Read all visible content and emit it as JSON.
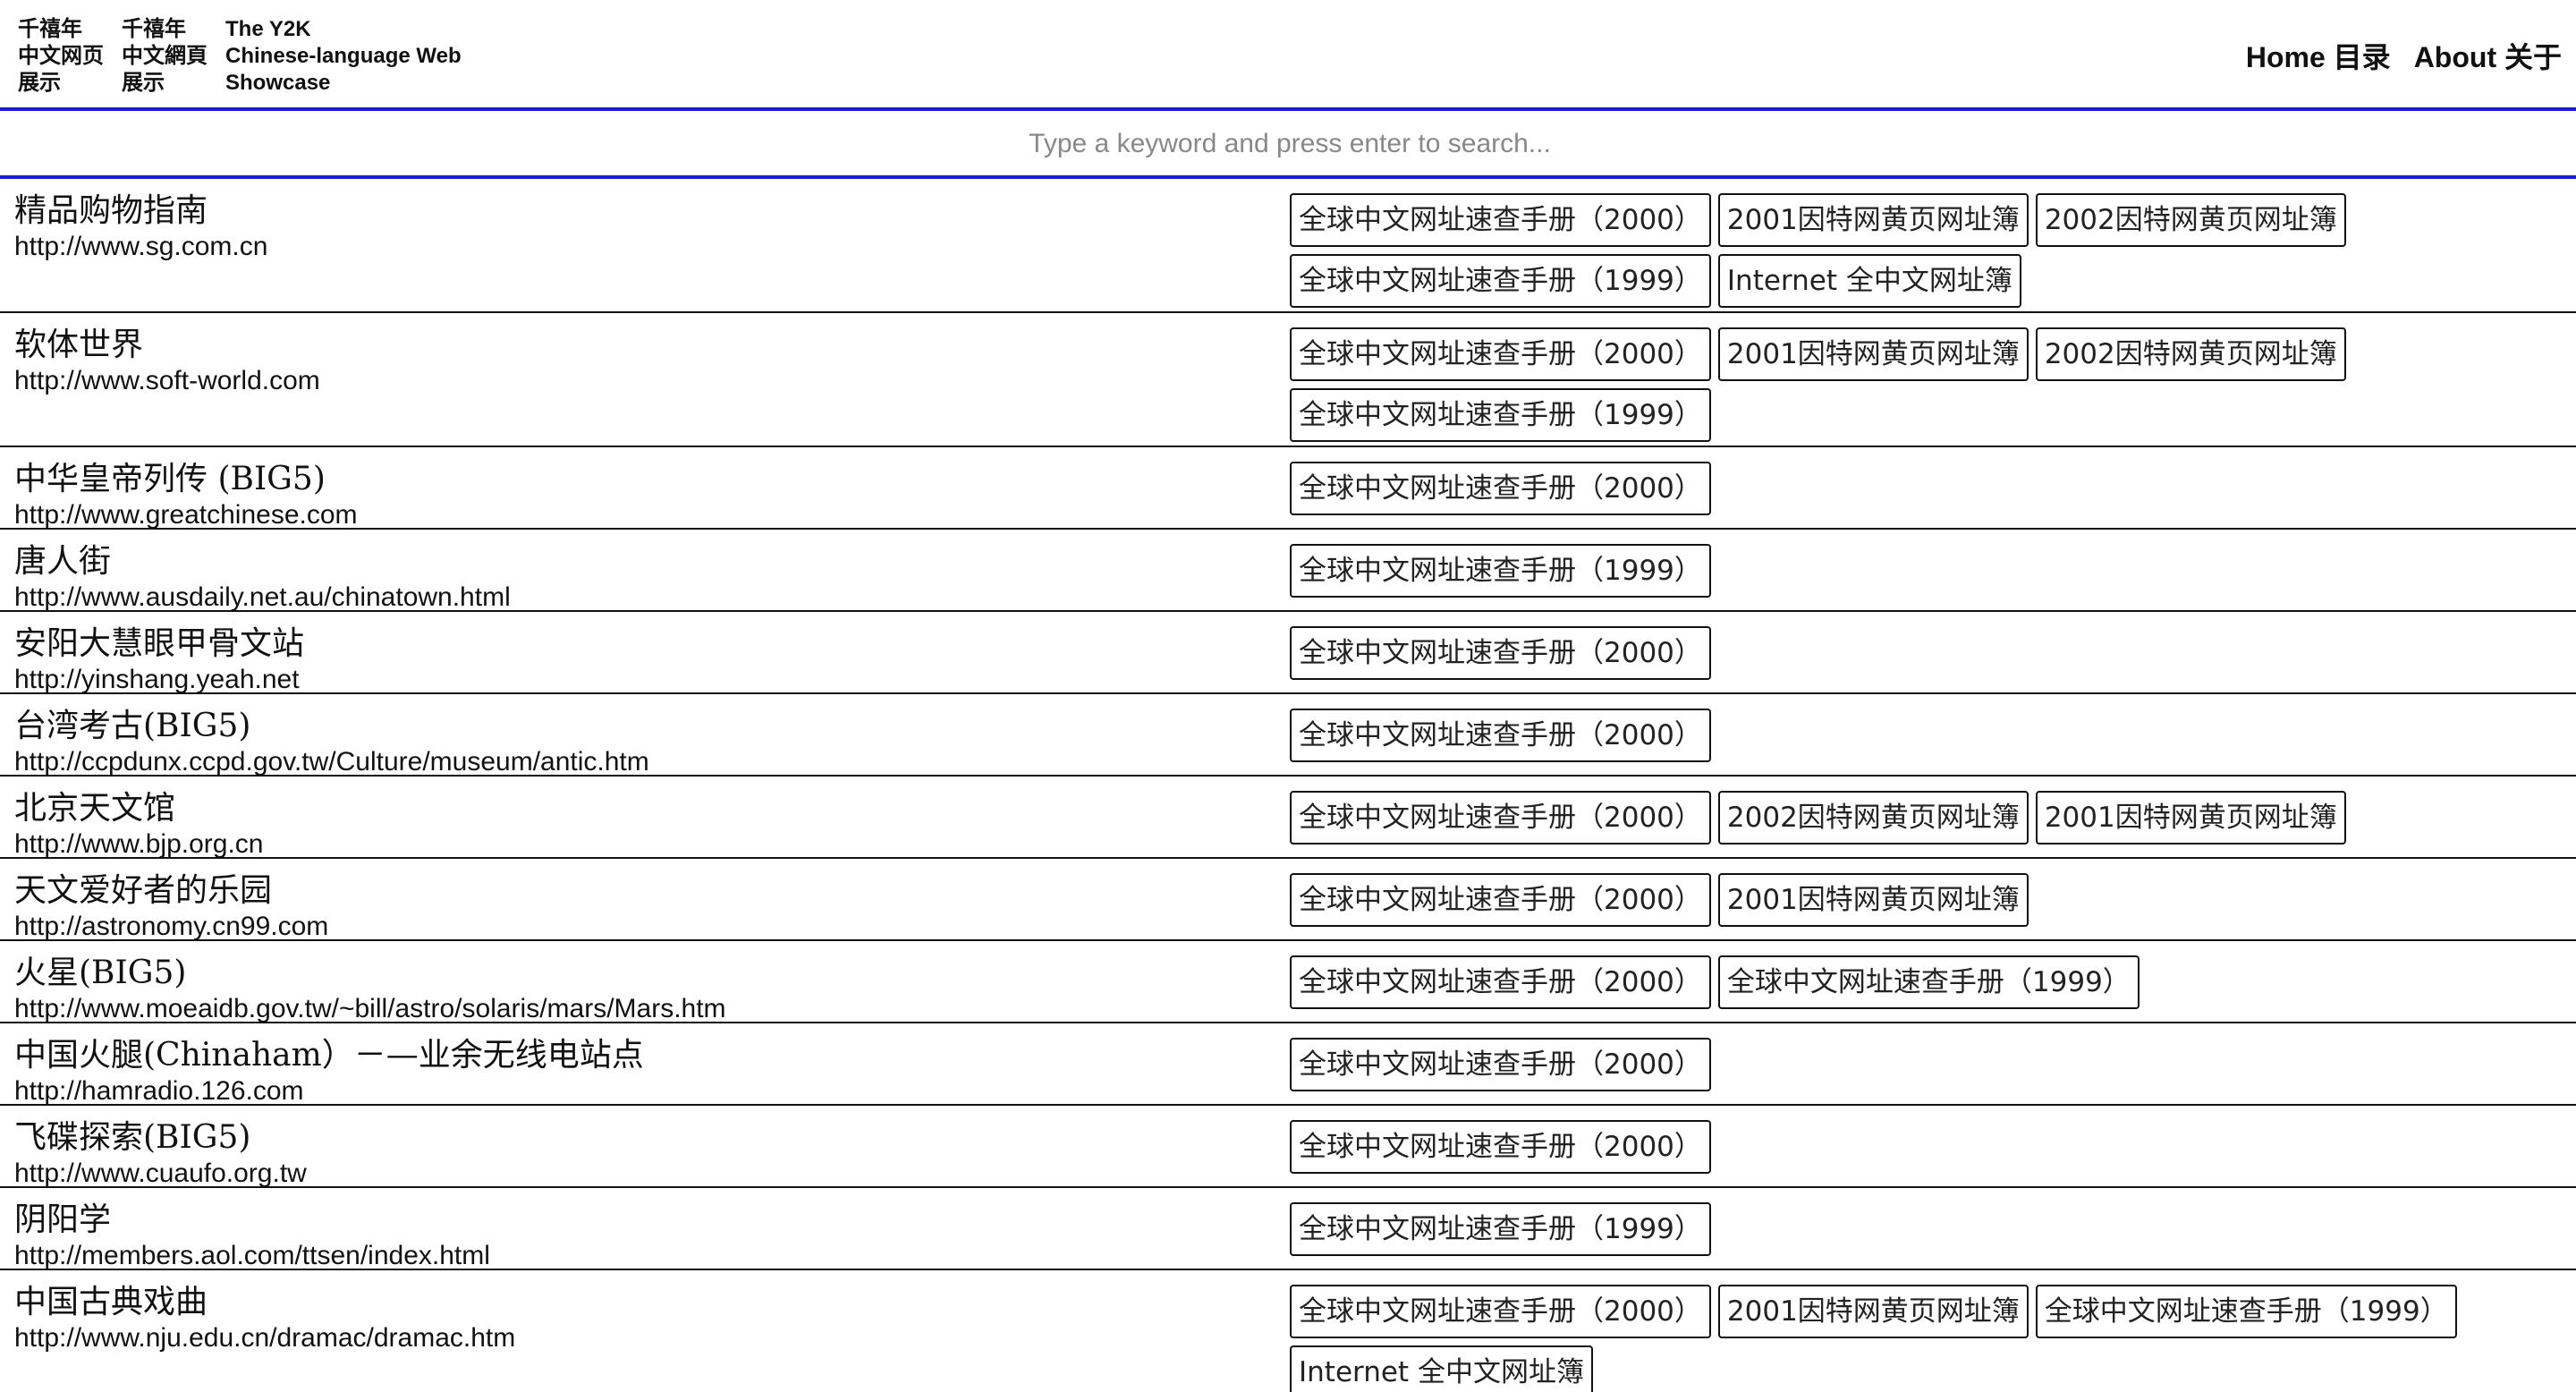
{
  "header": {
    "brand": {
      "col1": [
        "千禧年",
        "中文网页",
        "展示"
      ],
      "col2": [
        "千禧年",
        "中文網頁",
        "展示"
      ],
      "col3": [
        "The Y2K",
        "Chinese-language Web",
        "Showcase"
      ]
    },
    "nav": {
      "home": "Home 目录",
      "about": "About 关于"
    }
  },
  "search": {
    "placeholder": "Type a keyword and press enter to search...",
    "value": ""
  },
  "listings": [
    {
      "title": "精品购物指南",
      "url": "http://www.sg.com.cn",
      "tags": [
        "全球中文网址速查手册（2000）",
        "2001因特网黄页网址簿",
        "2002因特网黄页网址簿",
        "全球中文网址速查手册（1999）",
        "Internet 全中文网址簿"
      ]
    },
    {
      "title": "软体世界",
      "url": "http://www.soft-world.com",
      "tags": [
        "全球中文网址速查手册（2000）",
        "2001因特网黄页网址簿",
        "2002因特网黄页网址簿",
        "全球中文网址速查手册（1999）"
      ]
    },
    {
      "title": "中华皇帝列传 (BIG5)",
      "url": "http://www.greatchinese.com",
      "tags": [
        "全球中文网址速查手册（2000）"
      ]
    },
    {
      "title": "唐人街",
      "url": "http://www.ausdaily.net.au/chinatown.html",
      "tags": [
        "全球中文网址速查手册（1999）"
      ]
    },
    {
      "title": "安阳大慧眼甲骨文站",
      "url": "http://yinshang.yeah.net",
      "tags": [
        "全球中文网址速查手册（2000）"
      ]
    },
    {
      "title": "台湾考古(BIG5)",
      "url": "http://ccpdunx.ccpd.gov.tw/Culture/museum/antic.htm",
      "tags": [
        "全球中文网址速查手册（2000）"
      ]
    },
    {
      "title": "北京天文馆",
      "url": "http://www.bjp.org.cn",
      "tags": [
        "全球中文网址速查手册（2000）",
        "2002因特网黄页网址簿",
        "2001因特网黄页网址簿"
      ]
    },
    {
      "title": "天文爱好者的乐园",
      "url": "http://astronomy.cn99.com",
      "tags": [
        "全球中文网址速查手册（2000）",
        "2001因特网黄页网址簿"
      ]
    },
    {
      "title": "火星(BIG5)",
      "url": "http://www.moeaidb.gov.tw/~bill/astro/solaris/mars/Mars.htm",
      "tags": [
        "全球中文网址速查手册（2000）",
        "全球中文网址速查手册（1999）"
      ]
    },
    {
      "title": "中国火腿(Chinaham）－—业余无线电站点",
      "url": "http://hamradio.126.com",
      "tags": [
        "全球中文网址速查手册（2000）"
      ]
    },
    {
      "title": "飞碟探索(BIG5)",
      "url": "http://www.cuaufo.org.tw",
      "tags": [
        "全球中文网址速查手册（2000）"
      ]
    },
    {
      "title": "阴阳学",
      "url": "http://members.aol.com/ttsen/index.html",
      "tags": [
        "全球中文网址速查手册（1999）"
      ]
    },
    {
      "title": "中国古典戏曲",
      "url": "http://www.nju.edu.cn/dramac/dramac.htm",
      "tags": [
        "全球中文网址速查手册（2000）",
        "2001因特网黄页网址簿",
        "全球中文网址速查手册（1999）",
        "Internet 全中文网址簿"
      ]
    }
  ],
  "colors": {
    "rule_accent": "#1d1dd6",
    "text": "#111111",
    "placeholder": "#888888"
  }
}
